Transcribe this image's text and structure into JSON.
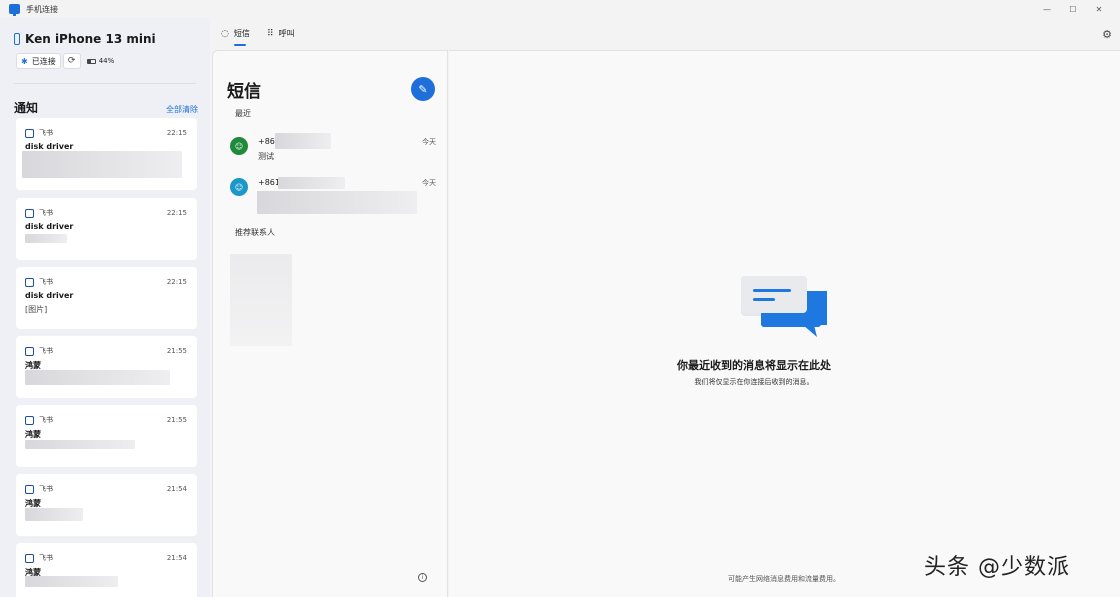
{
  "window": {
    "title": "手机连接",
    "controls": [
      "—",
      "☐",
      "✕"
    ]
  },
  "device": {
    "name": "Ken iPhone 13 mini",
    "connection_status": "已连接",
    "battery": "44%"
  },
  "notifications": {
    "title": "通知",
    "clear_all": "全部清除",
    "items": [
      {
        "app": "飞书",
        "time": "22:15",
        "sender": "disk driver",
        "body": ""
      },
      {
        "app": "飞书",
        "time": "22:15",
        "sender": "disk driver",
        "body": ""
      },
      {
        "app": "飞书",
        "time": "22:15",
        "sender": "disk driver",
        "body": "[图片]"
      },
      {
        "app": "飞书",
        "time": "21:55",
        "sender": "鸿蒙",
        "body": ""
      },
      {
        "app": "飞书",
        "time": "21:55",
        "sender": "鸿蒙",
        "body": ""
      },
      {
        "app": "飞书",
        "time": "21:54",
        "sender": "鸿蒙",
        "body": ""
      },
      {
        "app": "飞书",
        "time": "21:54",
        "sender": "鸿蒙",
        "body": ""
      }
    ]
  },
  "tabs": [
    {
      "label": "短信",
      "icon": "chat-icon",
      "active": true
    },
    {
      "label": "呼叫",
      "icon": "dialpad-icon",
      "active": false
    }
  ],
  "messages": {
    "title": "短信",
    "recent_label": "最近",
    "conversations": [
      {
        "number": "+86",
        "preview": "测试",
        "date": "今天",
        "avatar_color": "#1f8a3b"
      },
      {
        "number": "+861",
        "preview": "",
        "date": "今天",
        "avatar_color": "#1b98c7"
      }
    ],
    "suggested_label": "推荐联系人"
  },
  "detail": {
    "empty_title": "你最近收到的消息将显示在此处",
    "empty_subtitle": "我们将仅显示在你连接后收到的消息。",
    "footer": "可能产生网络消息费用和流量费用。"
  },
  "watermark": "头条 @少数派",
  "colors": {
    "accent": "#1e6fd9",
    "bubble_light": "#e6e8ec"
  }
}
